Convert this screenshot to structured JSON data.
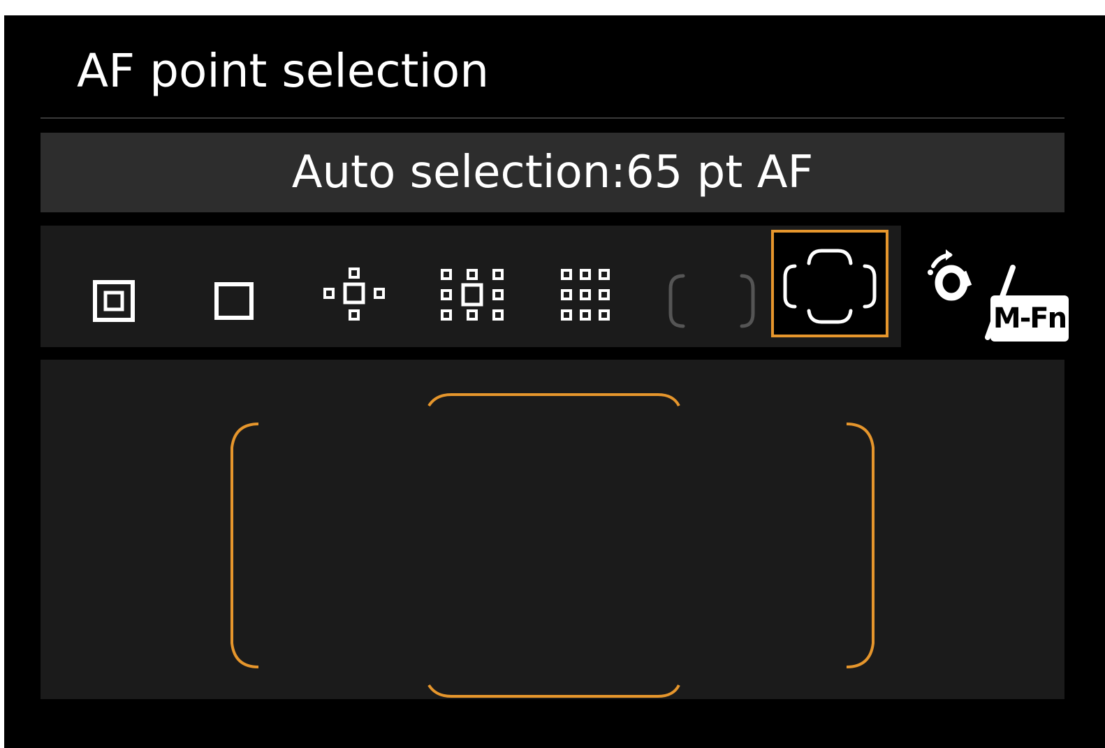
{
  "title": "AF point selection",
  "current_mode": "Auto selection:65 pt AF",
  "modes": [
    {
      "name": "spot-af",
      "icon": "spot-af-icon"
    },
    {
      "name": "single-point-af",
      "icon": "single-point-icon"
    },
    {
      "name": "af-point-expansion-4",
      "icon": "expansion-cross-icon"
    },
    {
      "name": "af-point-expansion-surround",
      "icon": "expansion-surround-icon"
    },
    {
      "name": "zone-af",
      "icon": "zone-af-icon"
    },
    {
      "name": "large-zone-af",
      "icon": "large-zone-icon"
    },
    {
      "name": "auto-selection-65pt",
      "icon": "auto-selection-icon",
      "selected": true
    }
  ],
  "mfn_hint": {
    "label": "M-Fn",
    "icon": "main-dial-icon"
  },
  "colors": {
    "accent": "#e6962c",
    "background": "#000000",
    "panel": "#1b1b1b",
    "banner": "#2d2d2d",
    "text": "#ffffff",
    "inactive": "#555555"
  }
}
